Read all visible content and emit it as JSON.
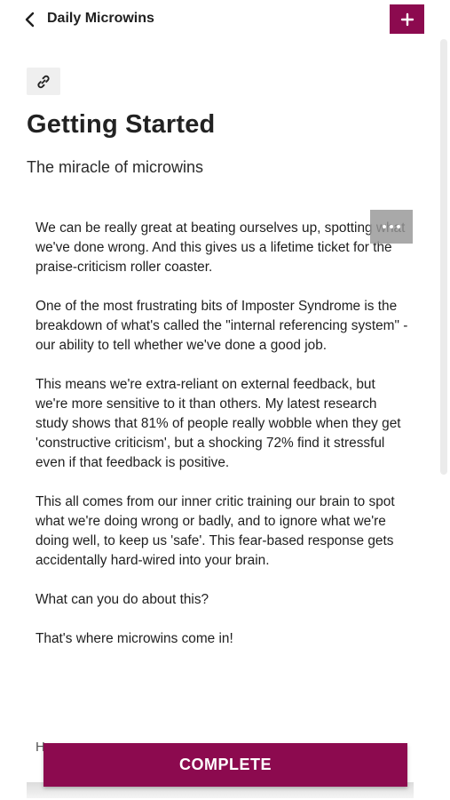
{
  "header": {
    "back_icon": "chevron-left-icon",
    "title": "Daily Microwins",
    "add_icon": "plus-icon"
  },
  "link_chip": {
    "icon": "link-icon"
  },
  "article": {
    "title": "Getting Started",
    "subtitle": "The miracle of microwins",
    "paragraphs": [
      "We can be really great at beating ourselves up, spotting what we've done wrong. And this gives us a lifetime ticket for the praise-criticism roller coaster.",
      "One of the most frustrating bits of Imposter Syndrome is the breakdown of what's called the \"internal referencing system\" - our ability to tell whether we've done a good job.",
      "This means we're extra-reliant on external feedback, but we're more sensitive to it than others. My latest research study shows that 81% of people really wobble when they get 'constructive criticism', but a shocking 72% find it stressful even if that feedback is positive.",
      "This all comes from our inner critic training our brain to spot what we're doing wrong or badly, and to ignore what we're doing well, to keep us 'safe'. This fear-based response gets accidentally hard-wired into your brain.",
      "What can you do about this?",
      "That's where microwins come in!"
    ],
    "cut_off_text": "H"
  },
  "more_menu": {
    "icon": "more-horizontal-icon"
  },
  "complete_button": {
    "label": "COMPLETE"
  },
  "colors": {
    "accent": "#8c0a4f"
  }
}
